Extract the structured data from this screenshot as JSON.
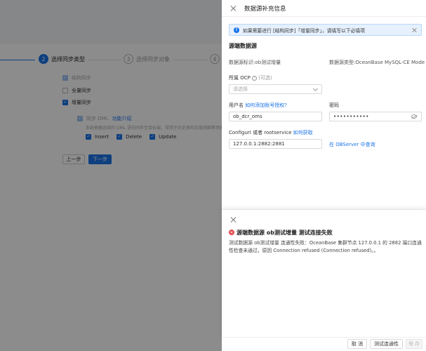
{
  "background": {
    "steps": [
      {
        "num": "2",
        "label": "选择同步类型"
      },
      {
        "num": "3",
        "label": "选择同步对象"
      },
      {
        "num": "4",
        "label": ""
      }
    ],
    "sync_options": {
      "structure_sync": "结构同步",
      "full_sync": "全量同步",
      "incremental_sync": "增量同步",
      "dml_sync": "同步 DML",
      "dml_link": "功能介绍",
      "dml_desc": "系统根据选择的 DML 语句同步至目标端，常用于历史表和交易明细等场景",
      "insert": "Insert",
      "delete": "Delete",
      "update": "Update"
    },
    "prev_button": "上一步",
    "next_button": "下一步"
  },
  "drawer": {
    "title": "数据源补充信息",
    "alert_text": "如果需要进行 [结构同步]「增量同步」，请填写以下必填项",
    "section_title": "源端数据源",
    "datasource_id_label": "数据源标识:ob测试增量",
    "datasource_type_label": "数据源类型:OceanBase MySQL-CE Mode",
    "ocp_label": "所属 OCP",
    "ocp_optional": "(可选)",
    "ocp_placeholder": "请选择",
    "username_label": "用户名",
    "username_link": "如何添加账号授权?",
    "username_value": "ob_dcr_oms",
    "password_label": "密码",
    "password_value": "•••••••••••",
    "configurl_label": "ConfigurI 或者 rootservice",
    "configurl_link": "如何获取",
    "configurl_value": "127.0.0.1:2882:2881",
    "observer_link": "在 OBServer 中查询"
  },
  "error": {
    "title": "源端数据源 ob测试增量 测试连接失败",
    "message": "测试数据源 ob测试增量 连通性失败：OceanBase 集群节点 127.0.0.1 的 2882 端口连通性检查未通过，原因 Connection refused (Connection refused)。。"
  },
  "footer": {
    "cancel": "取 消",
    "test_connection": "测试连通性",
    "save": "保 存"
  },
  "colors": {
    "accent": "#1a73e8",
    "error": "#e5484d",
    "alert_bg": "#e6f1fd"
  }
}
